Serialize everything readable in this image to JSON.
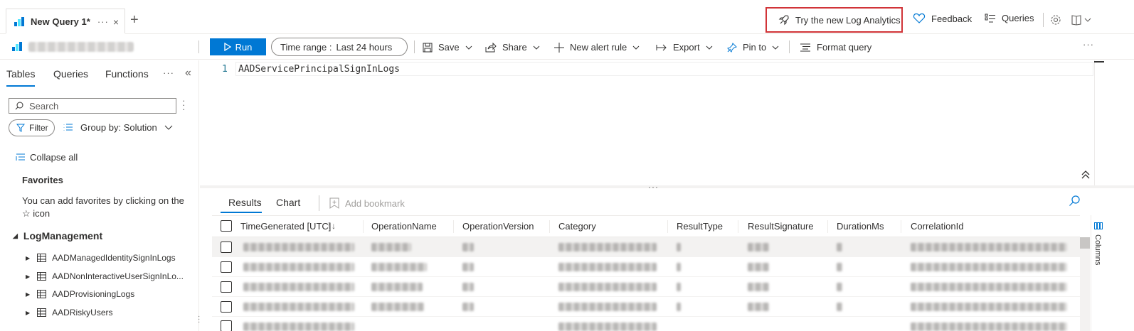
{
  "tab": {
    "title": "New Query 1*",
    "more": "···",
    "close": "×",
    "add": "+"
  },
  "top_actions": {
    "try_new": "Try the new Log Analytics",
    "feedback": "Feedback",
    "queries": "Queries"
  },
  "toolbar": {
    "run": "Run",
    "time_range_label": "Time range :",
    "time_range_value": "Last 24 hours",
    "save": "Save",
    "share": "Share",
    "new_alert_rule": "New alert rule",
    "export": "Export",
    "pin_to": "Pin to",
    "format_query": "Format query",
    "more": "···"
  },
  "left_panel": {
    "tabs": [
      "Tables",
      "Queries",
      "Functions"
    ],
    "more": "···",
    "collapse_glyph": "«",
    "search_placeholder": "Search",
    "filter": "Filter",
    "group_by": "Group by: Solution",
    "collapse_all": "Collapse all",
    "favorites_title": "Favorites",
    "favorites_desc": "You can add favorites by clicking on the ☆ icon",
    "log_management": "LogManagement",
    "tables": [
      "AADManagedIdentitySignInLogs",
      "AADNonInteractiveUserSignInLo...",
      "AADProvisioningLogs",
      "AADRiskyUsers"
    ]
  },
  "editor": {
    "line_number": "1",
    "code": "AADServicePrincipalSignInLogs"
  },
  "results": {
    "tabs": [
      "Results",
      "Chart"
    ],
    "add_bookmark": "Add bookmark",
    "columns": [
      "TimeGenerated [UTC]",
      "OperationName",
      "OperationVersion",
      "Category",
      "ResultType",
      "ResultSignature",
      "DurationMs",
      "CorrelationId"
    ],
    "sort_glyph": "↑↓",
    "columns_panel_label": "Columns"
  },
  "colors": {
    "accent": "#0078d4",
    "highlight_border": "#d13438"
  },
  "icons": [
    "log-analytics-icon",
    "rocket-icon",
    "heart-icon",
    "queries-list-icon",
    "gear-icon",
    "book-icon",
    "play-icon",
    "save-icon",
    "share-icon",
    "plus-icon",
    "export-arrow-icon",
    "pin-icon",
    "format-lines-icon",
    "search-icon",
    "filter-icon",
    "group-list-icon",
    "collapse-all-icon",
    "table-grid-icon",
    "bookmark-icon"
  ]
}
